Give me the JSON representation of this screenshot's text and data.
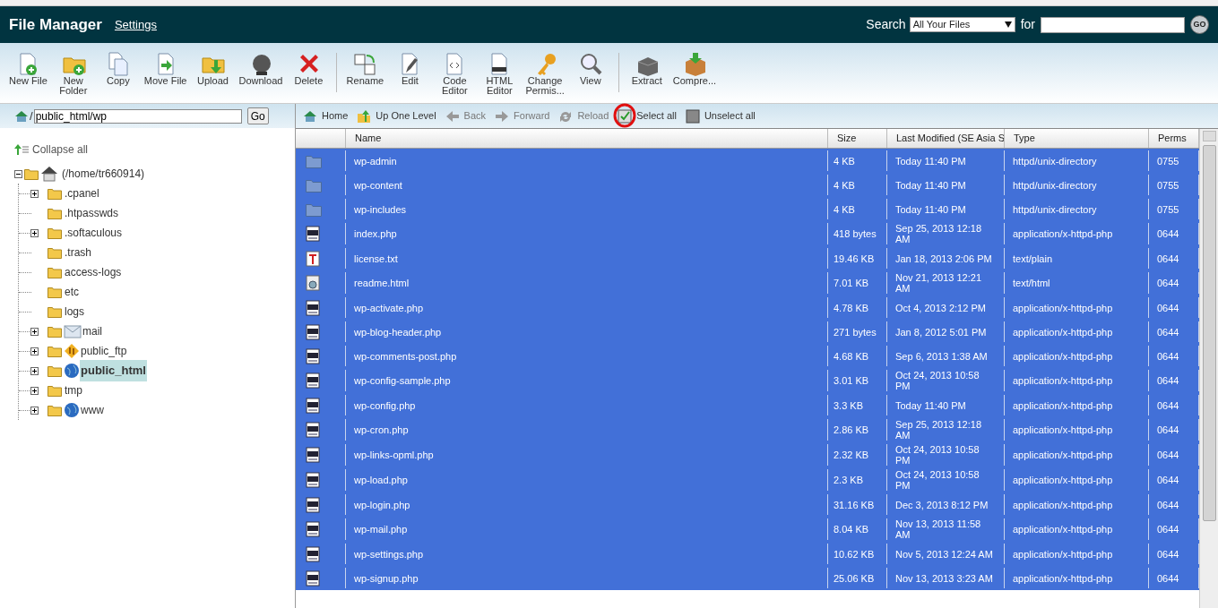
{
  "header": {
    "title": "File Manager",
    "settings_link": "Settings",
    "search_label": "Search",
    "search_scope": "All Your Files",
    "for_label": "for",
    "go_button": "GO"
  },
  "toolbar": [
    {
      "kind": "new-file",
      "label": "New File"
    },
    {
      "kind": "new-folder",
      "label": "New\nFolder"
    },
    {
      "kind": "copy",
      "label": "Copy"
    },
    {
      "kind": "move",
      "label": "Move File"
    },
    {
      "kind": "upload",
      "label": "Upload"
    },
    {
      "kind": "download",
      "label": "Download"
    },
    {
      "kind": "delete",
      "label": "Delete"
    },
    {
      "kind": "separator"
    },
    {
      "kind": "rename",
      "label": "Rename"
    },
    {
      "kind": "edit",
      "label": "Edit"
    },
    {
      "kind": "code",
      "label": "Code\nEditor"
    },
    {
      "kind": "html",
      "label": "HTML\nEditor"
    },
    {
      "kind": "permissions",
      "label": "Change\nPermis..."
    },
    {
      "kind": "view",
      "label": "View"
    },
    {
      "kind": "separator"
    },
    {
      "kind": "extract",
      "label": "Extract"
    },
    {
      "kind": "compress",
      "label": "Compre..."
    }
  ],
  "path_bar": {
    "separator": "/",
    "value": "public_html/wp",
    "go_button": "Go"
  },
  "nav": [
    {
      "kind": "home",
      "label": "Home",
      "disabled": false
    },
    {
      "kind": "up",
      "label": "Up One Level",
      "disabled": false
    },
    {
      "kind": "back",
      "label": "Back",
      "disabled": true
    },
    {
      "kind": "forward",
      "label": "Forward",
      "disabled": true
    },
    {
      "kind": "reload",
      "label": "Reload",
      "disabled": true
    },
    {
      "kind": "select-all",
      "label": "Select all",
      "disabled": false
    },
    {
      "kind": "unselect-all",
      "label": "Unselect all",
      "disabled": false
    }
  ],
  "tree": {
    "collapse_all": "Collapse all",
    "root": {
      "label": "(/home/tr660914)",
      "kind": "home",
      "expanded": true,
      "children": [
        {
          "label": ".cpanel",
          "kind": "folder",
          "expandable": true,
          "selected": false
        },
        {
          "label": ".htpasswds",
          "kind": "folder",
          "expandable": false,
          "selected": false
        },
        {
          "label": ".softaculous",
          "kind": "folder",
          "expandable": true,
          "selected": false
        },
        {
          "label": ".trash",
          "kind": "folder",
          "expandable": false,
          "selected": false
        },
        {
          "label": "access-logs",
          "kind": "folder",
          "expandable": false,
          "selected": false
        },
        {
          "label": "etc",
          "kind": "folder",
          "expandable": false,
          "selected": false
        },
        {
          "label": "logs",
          "kind": "folder",
          "expandable": false,
          "selected": false
        },
        {
          "label": "mail",
          "kind": "mail",
          "expandable": true,
          "selected": false
        },
        {
          "label": "public_ftp",
          "kind": "ftp",
          "expandable": true,
          "selected": false
        },
        {
          "label": "public_html",
          "kind": "web",
          "expandable": true,
          "selected": true
        },
        {
          "label": "tmp",
          "kind": "folder",
          "expandable": true,
          "selected": false
        },
        {
          "label": "www",
          "kind": "web",
          "expandable": true,
          "selected": false
        }
      ]
    }
  },
  "table": {
    "columns": [
      "Name",
      "Size",
      "Last Modified (SE Asia S",
      "Type",
      "Perms"
    ],
    "rows": [
      {
        "kind": "folder",
        "name": "wp-admin",
        "size": "4 KB",
        "modified": "Today 11:40 PM",
        "type": "httpd/unix-directory",
        "perms": "0755",
        "selected": true
      },
      {
        "kind": "folder",
        "name": "wp-content",
        "size": "4 KB",
        "modified": "Today 11:40 PM",
        "type": "httpd/unix-directory",
        "perms": "0755",
        "selected": true
      },
      {
        "kind": "folder",
        "name": "wp-includes",
        "size": "4 KB",
        "modified": "Today 11:40 PM",
        "type": "httpd/unix-directory",
        "perms": "0755",
        "selected": true
      },
      {
        "kind": "php",
        "name": "index.php",
        "size": "418 bytes",
        "modified": "Sep 25, 2013 12:18 AM",
        "type": "application/x-httpd-php",
        "perms": "0644",
        "selected": true
      },
      {
        "kind": "text",
        "name": "license.txt",
        "size": "19.46 KB",
        "modified": "Jan 18, 2013 2:06 PM",
        "type": "text/plain",
        "perms": "0644",
        "selected": true
      },
      {
        "kind": "html",
        "name": "readme.html",
        "size": "7.01 KB",
        "modified": "Nov 21, 2013 12:21 AM",
        "type": "text/html",
        "perms": "0644",
        "selected": true
      },
      {
        "kind": "php",
        "name": "wp-activate.php",
        "size": "4.78 KB",
        "modified": "Oct 4, 2013 2:12 PM",
        "type": "application/x-httpd-php",
        "perms": "0644",
        "selected": true
      },
      {
        "kind": "php",
        "name": "wp-blog-header.php",
        "size": "271 bytes",
        "modified": "Jan 8, 2012 5:01 PM",
        "type": "application/x-httpd-php",
        "perms": "0644",
        "selected": true
      },
      {
        "kind": "php",
        "name": "wp-comments-post.php",
        "size": "4.68 KB",
        "modified": "Sep 6, 2013 1:38 AM",
        "type": "application/x-httpd-php",
        "perms": "0644",
        "selected": true
      },
      {
        "kind": "php",
        "name": "wp-config-sample.php",
        "size": "3.01 KB",
        "modified": "Oct 24, 2013 10:58 PM",
        "type": "application/x-httpd-php",
        "perms": "0644",
        "selected": true
      },
      {
        "kind": "php",
        "name": "wp-config.php",
        "size": "3.3 KB",
        "modified": "Today 11:40 PM",
        "type": "application/x-httpd-php",
        "perms": "0644",
        "selected": true
      },
      {
        "kind": "php",
        "name": "wp-cron.php",
        "size": "2.86 KB",
        "modified": "Sep 25, 2013 12:18 AM",
        "type": "application/x-httpd-php",
        "perms": "0644",
        "selected": true
      },
      {
        "kind": "php",
        "name": "wp-links-opml.php",
        "size": "2.32 KB",
        "modified": "Oct 24, 2013 10:58 PM",
        "type": "application/x-httpd-php",
        "perms": "0644",
        "selected": true
      },
      {
        "kind": "php",
        "name": "wp-load.php",
        "size": "2.3 KB",
        "modified": "Oct 24, 2013 10:58 PM",
        "type": "application/x-httpd-php",
        "perms": "0644",
        "selected": true
      },
      {
        "kind": "php",
        "name": "wp-login.php",
        "size": "31.16 KB",
        "modified": "Dec 3, 2013 8:12 PM",
        "type": "application/x-httpd-php",
        "perms": "0644",
        "selected": true
      },
      {
        "kind": "php",
        "name": "wp-mail.php",
        "size": "8.04 KB",
        "modified": "Nov 13, 2013 11:58 AM",
        "type": "application/x-httpd-php",
        "perms": "0644",
        "selected": true
      },
      {
        "kind": "php",
        "name": "wp-settings.php",
        "size": "10.62 KB",
        "modified": "Nov 5, 2013 12:24 AM",
        "type": "application/x-httpd-php",
        "perms": "0644",
        "selected": true
      },
      {
        "kind": "php",
        "name": "wp-signup.php",
        "size": "25.06 KB",
        "modified": "Nov 13, 2013 3:23 AM",
        "type": "application/x-httpd-php",
        "perms": "0644",
        "selected": true
      }
    ]
  }
}
